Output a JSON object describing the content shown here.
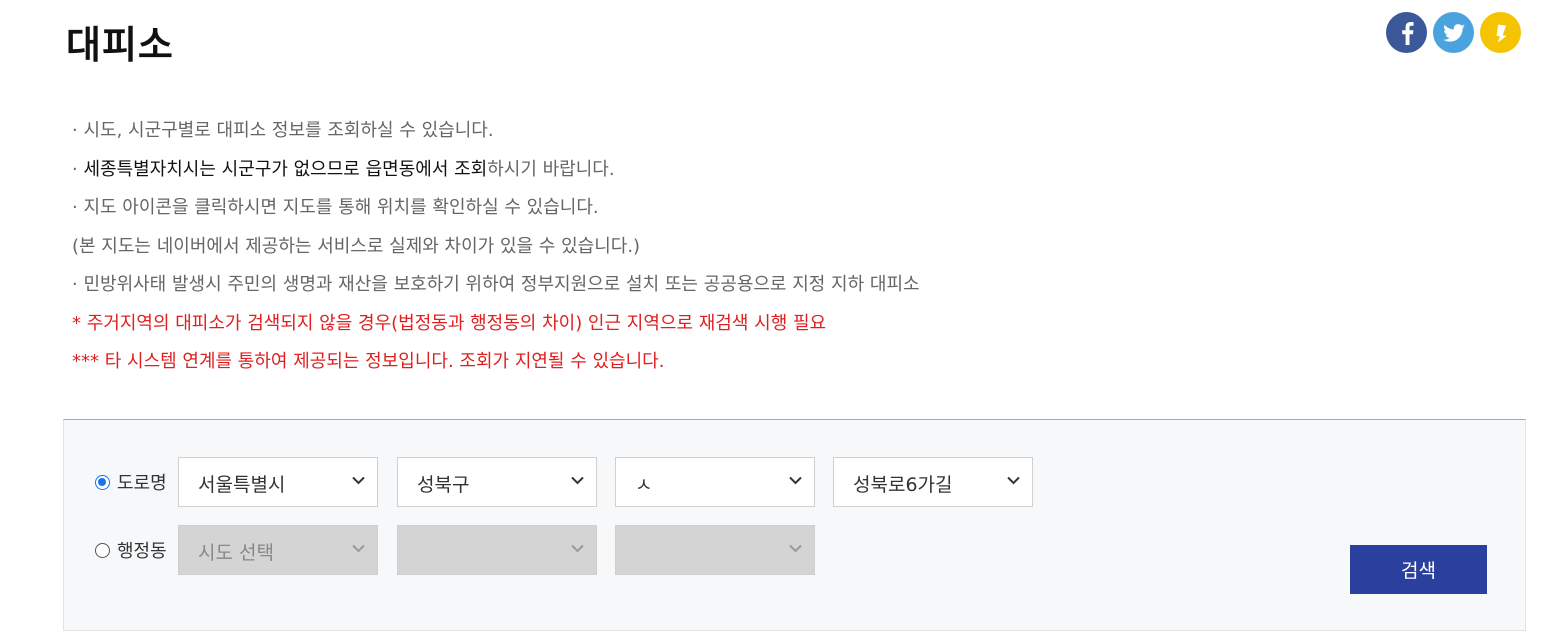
{
  "page": {
    "title": "대피소"
  },
  "share": {
    "facebook_color": "#3b5998",
    "twitter_color": "#4aa3df",
    "kakao_color": "#f5c400"
  },
  "notice": {
    "line1": "· 시도, 시군구별로 대피소 정보를 조회하실 수 있습니다.",
    "line2_prefix": "· ",
    "line2_strong": "세종특별자치시는 시군구가 없으므로 읍면동에서 조회",
    "line2_suffix": "하시기 바랍니다.",
    "line3": "· 지도 아이콘을 클릭하시면 지도를 통해 위치를 확인하실 수 있습니다.",
    "line4": "(본 지도는 네이버에서 제공하는 서비스로 실제와 차이가 있을 수 있습니다.)",
    "line5": "· 민방위사태 발생시 주민의 생명과 재산을 보호하기 위하여 정부지원으로 설치 또는 공공용으로 지정 지하 대피소",
    "line6": "* 주거지역의 대피소가 검색되지 않을 경우(법정동과 행정동의 차이) 인근 지역으로 재검색 시행 필요",
    "line7": "*** 타 시스템 연계를 통하여 제공되는 정보입니다. 조회가 지연될 수 있습니다."
  },
  "search": {
    "road": {
      "label": "도로명",
      "checked": true,
      "sido": "서울특별시",
      "sigungu": "성북구",
      "initial": "ㅅ",
      "road_name": "성북로6가길"
    },
    "admin": {
      "label": "행정동",
      "checked": false,
      "sido": "시도 선택",
      "sigungu": "",
      "dong": ""
    },
    "button_label": "검색",
    "button_color": "#2b3f9e"
  }
}
